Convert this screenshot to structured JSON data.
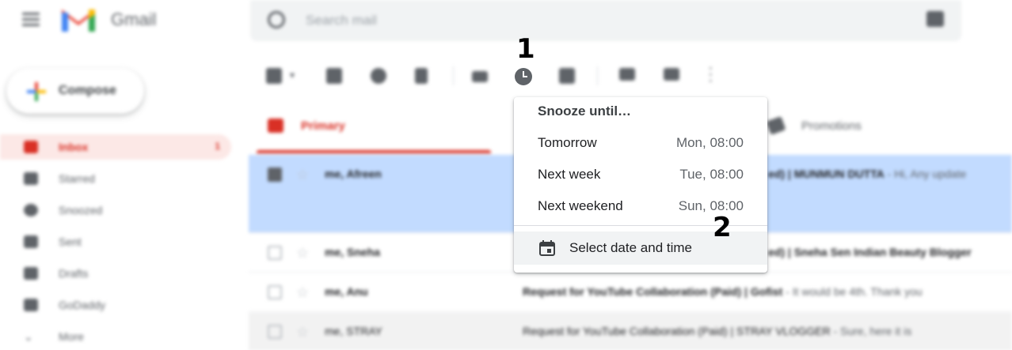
{
  "header": {
    "app_name": "Gmail",
    "search_placeholder": "Search mail"
  },
  "compose_label": "Compose",
  "sidebar": {
    "items": [
      {
        "label": "Inbox",
        "count": "1"
      },
      {
        "label": "Starred"
      },
      {
        "label": "Snoozed"
      },
      {
        "label": "Sent"
      },
      {
        "label": "Drafts"
      },
      {
        "label": "GoDaddy"
      },
      {
        "label": "More"
      }
    ]
  },
  "tabs": {
    "primary": "Primary",
    "promotions": "Promotions"
  },
  "emails": [
    {
      "sender": "me, Afreen",
      "subject": "ed) | MUNMUN DUTTA",
      "snippet": " - Hi, Any update",
      "selected": true
    },
    {
      "sender": "me, Sneha",
      "subject": "ed) | Sneha Sen Indian Beauty Blogger",
      "snippet": ""
    },
    {
      "sender": "me, Anu",
      "subject": "Request for YouTube Collaboration (Paid) | Gofist",
      "snippet": " - It would be 4th. Thank you"
    },
    {
      "sender": "me, STRAY",
      "subject": "Request for YouTube Collaboration (Paid) | STRAY VLOGGER",
      "snippet": " - Sure, here it is"
    }
  ],
  "annotations": {
    "step1": "1",
    "step2": "2"
  },
  "snooze_menu": {
    "header": "Snooze until…",
    "items": [
      {
        "label": "Tomorrow",
        "time": "Mon, 08:00"
      },
      {
        "label": "Next week",
        "time": "Tue, 08:00"
      },
      {
        "label": "Next weekend",
        "time": "Sun, 08:00"
      }
    ],
    "custom_label": "Select date and time"
  },
  "colors": {
    "accent_red": "#d93025",
    "selected_row": "#c2dbff",
    "icon_gray": "#5f6368"
  }
}
